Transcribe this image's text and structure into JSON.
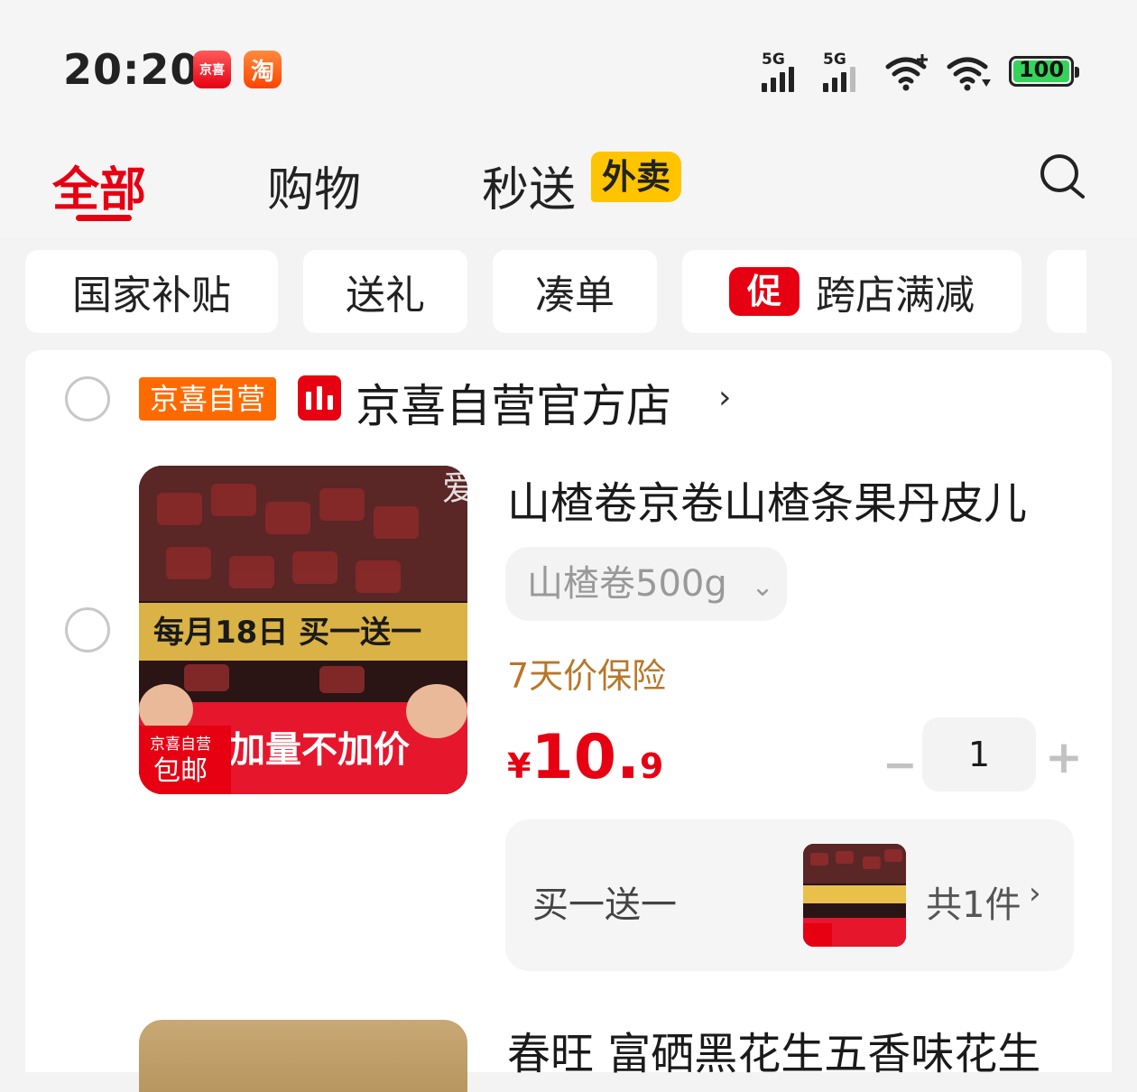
{
  "status_bar": {
    "time": "20:20",
    "app_icons": [
      {
        "name": "jd-jingxi-app-icon",
        "text": "京喜"
      },
      {
        "name": "taobao-app-icon",
        "text": "淘"
      }
    ],
    "signal1_label": "5G",
    "signal2_label": "5G",
    "battery": "100"
  },
  "tabs": {
    "all": "全部",
    "shopping": "购物",
    "delivery": "秒送",
    "delivery_badge": "外卖"
  },
  "chips": {
    "subsidy": "国家补贴",
    "gift": "送礼",
    "combine": "凑单",
    "promo_icon": "促",
    "cross_store": "跨店满减"
  },
  "store": {
    "tag": "京喜自营",
    "name": "京喜自营官方店",
    "arrow": "›"
  },
  "product": {
    "watermark": "爱吃爆肚",
    "title": "山楂卷京卷山楂条果丹皮儿",
    "spec": "山楂卷500g",
    "spec_arrow": "⌄",
    "insurance": "7天价保险",
    "price_symbol": "¥",
    "price_int": "10.",
    "price_dec": "9",
    "quantity": "1",
    "minus": "−",
    "plus": "+",
    "image_banner": "每月18日 买一送一",
    "image_tag_top": "京喜自营",
    "image_tag_bottom": "包邮",
    "image_slogan": "加量不加价"
  },
  "gift": {
    "label": "买一送一",
    "count": "共1件",
    "arrow": "›"
  },
  "next_product": {
    "title": "春旺 富硒黑花生五香味花生"
  },
  "colors": {
    "brand_red": "#e60012",
    "badge_yellow": "#ffc400",
    "store_orange": "#ff6a00",
    "insurance_brown": "#b8772a"
  }
}
